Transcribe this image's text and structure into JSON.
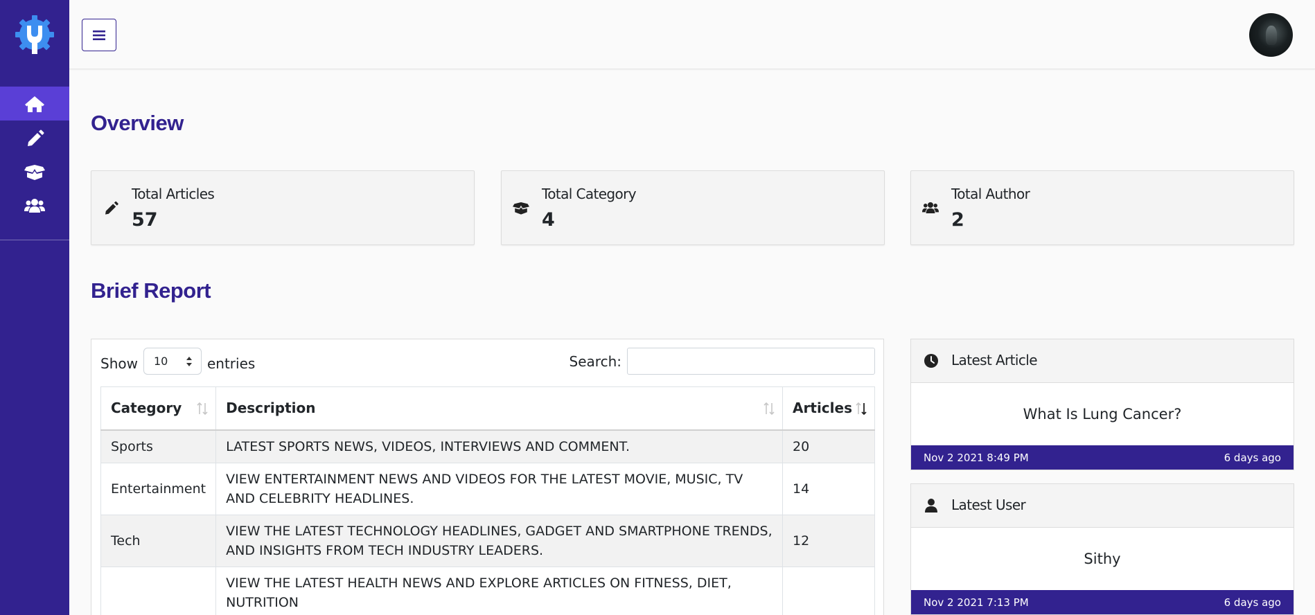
{
  "sidebar": {
    "items": [
      {
        "name": "home",
        "icon": "home-icon"
      },
      {
        "name": "articles",
        "icon": "pencil-icon"
      },
      {
        "name": "categories",
        "icon": "box-open-icon"
      },
      {
        "name": "authors",
        "icon": "users-icon"
      }
    ]
  },
  "overview": {
    "title": "Overview",
    "cards": [
      {
        "label": "Total Articles",
        "value": "57",
        "icon": "pencil-icon"
      },
      {
        "label": "Total Category",
        "value": "4",
        "icon": "box-open-icon"
      },
      {
        "label": "Total Author",
        "value": "2",
        "icon": "users-icon"
      }
    ]
  },
  "report": {
    "title": "Brief Report",
    "show_label": "Show",
    "show_value": "10",
    "entries_label": "entries",
    "search_label": "Search:",
    "search_value": "",
    "columns": [
      "Category",
      "Description",
      "Articles"
    ],
    "rows": [
      {
        "category": "Sports",
        "description": "LATEST SPORTS NEWS, VIDEOS, INTERVIEWS AND COMMENT.",
        "articles": "20"
      },
      {
        "category": "Entertainment",
        "description": "VIEW ENTERTAINMENT NEWS AND VIDEOS FOR THE LATEST MOVIE, MUSIC, TV AND CELEBRITY HEADLINES.",
        "articles": "14"
      },
      {
        "category": "Tech",
        "description": "VIEW THE LATEST TECHNOLOGY HEADLINES, GADGET AND SMARTPHONE TRENDS, AND INSIGHTS FROM TECH INDUSTRY LEADERS.",
        "articles": "12"
      },
      {
        "category": "",
        "description": "VIEW THE LATEST HEALTH NEWS AND EXPLORE ARTICLES ON FITNESS, DIET, NUTRITION",
        "articles": ""
      }
    ]
  },
  "latest_article": {
    "title": "Latest Article",
    "name": "What Is Lung Cancer?",
    "date": "Nov 2 2021 8:49 PM",
    "ago": "6 days ago"
  },
  "latest_user": {
    "title": "Latest User",
    "name": "Sithy",
    "date": "Nov 2 2021 7:13 PM",
    "ago": "6 days ago"
  },
  "colors": {
    "brand": "#32228f",
    "nav_active": "#5a3fd6",
    "background": "#fafafa"
  }
}
